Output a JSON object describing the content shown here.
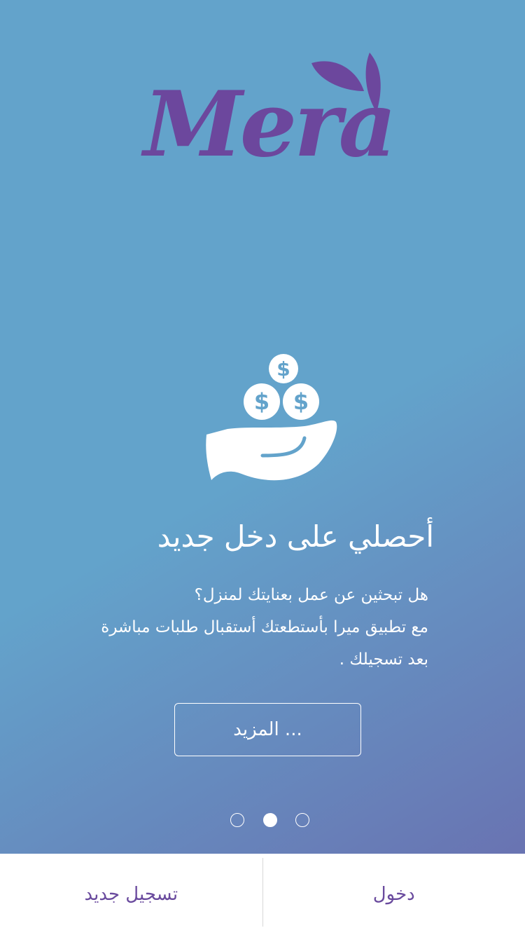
{
  "logo": {
    "text": "Mera",
    "color": "#6c479d"
  },
  "slide": {
    "icon": "hand-with-coins-icon",
    "title": "أحصلي على دخل جديد",
    "description_lines": [
      "هل تبحثين عن عمل بعنايتك لمنزل؟",
      "مع تطبيق ميرا بأستطعتك أستقبال طلبات مباشرة",
      "بعد تسجيلك ."
    ],
    "more_label": "المزيد ..."
  },
  "pager": {
    "count": 3,
    "active_index": 1
  },
  "bottom_bar": {
    "register_label": "تسجيل جديد",
    "login_label": "دخول"
  },
  "colors": {
    "background_top": "#63a3cb",
    "background_bottom": "#6a6cae",
    "accent": "#6a4b9e"
  }
}
